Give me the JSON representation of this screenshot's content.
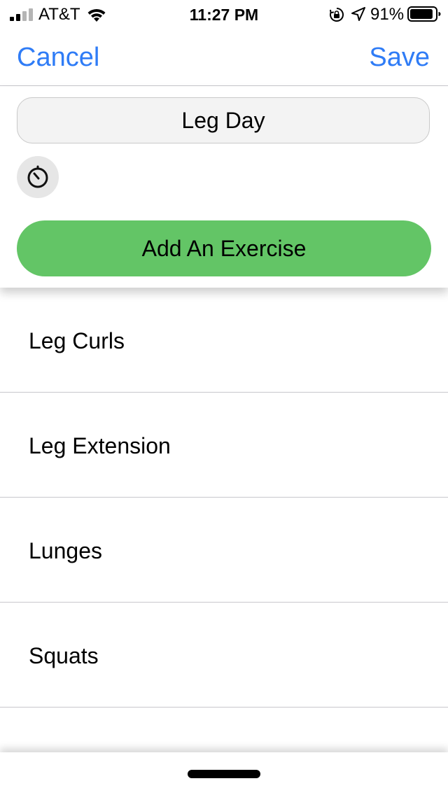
{
  "status_bar": {
    "carrier": "AT&T",
    "time": "11:27 PM",
    "battery_percent": "91%",
    "signal_bars_filled": 2,
    "battery_level": 0.91,
    "icons": [
      "signal-icon",
      "wifi-icon",
      "rotation-lock-icon",
      "location-arrow-icon",
      "battery-icon"
    ]
  },
  "nav": {
    "cancel_label": "Cancel",
    "save_label": "Save",
    "accent_color": "#2f7cf6"
  },
  "workout": {
    "name": "Leg Day",
    "timer_icon": "stopwatch-icon",
    "add_button_label": "Add An Exercise",
    "add_button_color": "#63c566"
  },
  "exercises": [
    {
      "name": "Leg Curls"
    },
    {
      "name": "Leg Extension"
    },
    {
      "name": "Lunges"
    },
    {
      "name": "Squats"
    }
  ]
}
